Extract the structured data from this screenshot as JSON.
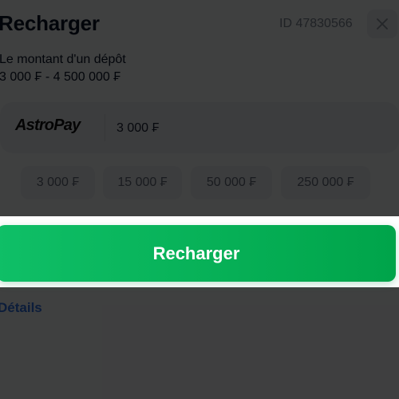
{
  "modal": {
    "title": "Recharger",
    "id_label": "ID 47830566",
    "description": {
      "line1": "Le montant d'un dépôt",
      "line2": "3 000 ₣ - 4 500 000 ₣"
    }
  },
  "payment": {
    "provider_logo": "AstroPay",
    "amount_value": "3 000 ₣"
  },
  "quick_amounts": [
    "3 000 ₣",
    "15 000 ₣",
    "50 000 ₣",
    "250 000 ₣"
  ],
  "actions": {
    "recharge_label": "Recharger",
    "details_label": "Détails"
  },
  "colors": {
    "accent_green": "#00a44a",
    "link_blue": "#2e6fde",
    "overlay": "rgba(0,0,0,0.74)"
  },
  "icons": {
    "close": "close-icon"
  }
}
